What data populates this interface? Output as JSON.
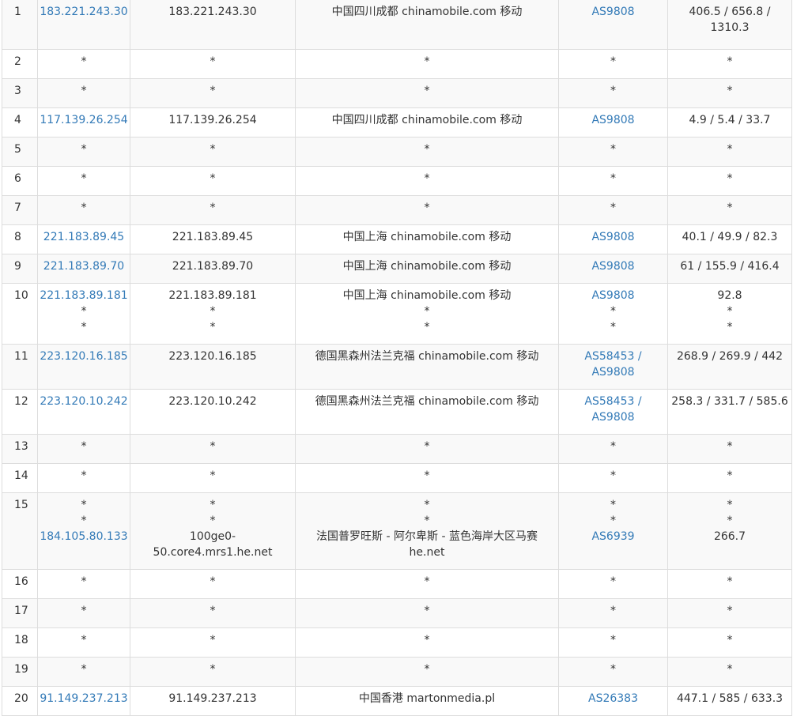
{
  "colors": {
    "link": "#337ab7",
    "text": "#333333",
    "border": "#dddddd",
    "stripe": "#f9f9f9"
  },
  "rows": [
    {
      "hop": "1",
      "ip": [
        "183.221.243.30"
      ],
      "host": [
        "183.221.243.30"
      ],
      "location": [
        "中国四川成都 chinamobile.com 移动"
      ],
      "asn": [
        "AS9808"
      ],
      "latency": [
        "406.5 / 656.8 /",
        "1310.3"
      ]
    },
    {
      "hop": "2",
      "ip": [
        "*"
      ],
      "host": [
        "*"
      ],
      "location": [
        "*"
      ],
      "asn": [
        "*"
      ],
      "latency": [
        "*"
      ]
    },
    {
      "hop": "3",
      "ip": [
        "*"
      ],
      "host": [
        "*"
      ],
      "location": [
        "*"
      ],
      "asn": [
        "*"
      ],
      "latency": [
        "*"
      ]
    },
    {
      "hop": "4",
      "ip": [
        "117.139.26.254"
      ],
      "host": [
        "117.139.26.254"
      ],
      "location": [
        "中国四川成都 chinamobile.com 移动"
      ],
      "asn": [
        "AS9808"
      ],
      "latency": [
        "4.9 / 5.4 / 33.7"
      ]
    },
    {
      "hop": "5",
      "ip": [
        "*"
      ],
      "host": [
        "*"
      ],
      "location": [
        "*"
      ],
      "asn": [
        "*"
      ],
      "latency": [
        "*"
      ]
    },
    {
      "hop": "6",
      "ip": [
        "*"
      ],
      "host": [
        "*"
      ],
      "location": [
        "*"
      ],
      "asn": [
        "*"
      ],
      "latency": [
        "*"
      ]
    },
    {
      "hop": "7",
      "ip": [
        "*"
      ],
      "host": [
        "*"
      ],
      "location": [
        "*"
      ],
      "asn": [
        "*"
      ],
      "latency": [
        "*"
      ]
    },
    {
      "hop": "8",
      "ip": [
        "221.183.89.45"
      ],
      "host": [
        "221.183.89.45"
      ],
      "location": [
        "中国上海 chinamobile.com 移动"
      ],
      "asn": [
        "AS9808"
      ],
      "latency": [
        "40.1 / 49.9 / 82.3"
      ]
    },
    {
      "hop": "9",
      "ip": [
        "221.183.89.70"
      ],
      "host": [
        "221.183.89.70"
      ],
      "location": [
        "中国上海 chinamobile.com 移动"
      ],
      "asn": [
        "AS9808"
      ],
      "latency": [
        "61 / 155.9 / 416.4"
      ]
    },
    {
      "hop": "10",
      "ip": [
        "221.183.89.181",
        "*",
        "*"
      ],
      "host": [
        "221.183.89.181",
        "*",
        "*"
      ],
      "location": [
        "中国上海 chinamobile.com 移动",
        "*",
        "*"
      ],
      "asn": [
        "AS9808",
        "*",
        "*"
      ],
      "latency": [
        "92.8",
        "*",
        "*"
      ]
    },
    {
      "hop": "11",
      "ip": [
        "223.120.16.185"
      ],
      "host": [
        "223.120.16.185"
      ],
      "location": [
        "德国黑森州法兰克福 chinamobile.com 移动"
      ],
      "asn": [
        "AS58453 /",
        "AS9808"
      ],
      "latency": [
        "268.9 / 269.9 / 442"
      ]
    },
    {
      "hop": "12",
      "ip": [
        "223.120.10.242"
      ],
      "host": [
        "223.120.10.242"
      ],
      "location": [
        "德国黑森州法兰克福 chinamobile.com 移动"
      ],
      "asn": [
        "AS58453 /",
        "AS9808"
      ],
      "latency": [
        "258.3 / 331.7 / 585.6"
      ]
    },
    {
      "hop": "13",
      "ip": [
        "*"
      ],
      "host": [
        "*"
      ],
      "location": [
        "*"
      ],
      "asn": [
        "*"
      ],
      "latency": [
        "*"
      ]
    },
    {
      "hop": "14",
      "ip": [
        "*"
      ],
      "host": [
        "*"
      ],
      "location": [
        "*"
      ],
      "asn": [
        "*"
      ],
      "latency": [
        "*"
      ]
    },
    {
      "hop": "15",
      "ip": [
        "*",
        "*",
        "184.105.80.133"
      ],
      "host": [
        "*",
        "*",
        "100ge0-",
        "50.core4.mrs1.he.net"
      ],
      "location": [
        "*",
        "*",
        "法国普罗旺斯 - 阿尔卑斯 - 蓝色海岸大区马赛",
        "he.net"
      ],
      "asn": [
        "*",
        "*",
        "AS6939"
      ],
      "latency": [
        "*",
        "*",
        "266.7"
      ]
    },
    {
      "hop": "16",
      "ip": [
        "*"
      ],
      "host": [
        "*"
      ],
      "location": [
        "*"
      ],
      "asn": [
        "*"
      ],
      "latency": [
        "*"
      ]
    },
    {
      "hop": "17",
      "ip": [
        "*"
      ],
      "host": [
        "*"
      ],
      "location": [
        "*"
      ],
      "asn": [
        "*"
      ],
      "latency": [
        "*"
      ]
    },
    {
      "hop": "18",
      "ip": [
        "*"
      ],
      "host": [
        "*"
      ],
      "location": [
        "*"
      ],
      "asn": [
        "*"
      ],
      "latency": [
        "*"
      ]
    },
    {
      "hop": "19",
      "ip": [
        "*"
      ],
      "host": [
        "*"
      ],
      "location": [
        "*"
      ],
      "asn": [
        "*"
      ],
      "latency": [
        "*"
      ]
    },
    {
      "hop": "20",
      "ip": [
        "91.149.237.213"
      ],
      "host": [
        "91.149.237.213"
      ],
      "location": [
        "中国香港 martonmedia.pl"
      ],
      "asn": [
        "AS26383"
      ],
      "latency": [
        "447.1 / 585 / 633.3"
      ]
    }
  ]
}
